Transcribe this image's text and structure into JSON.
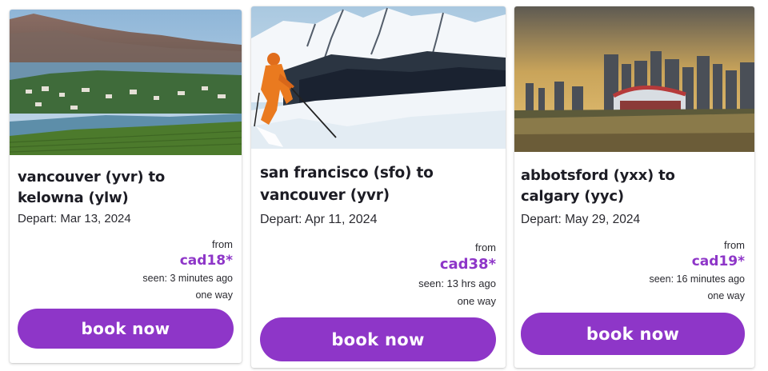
{
  "deals": [
    {
      "route_line1": "vancouver (yvr) to",
      "route_line2": "kelowna (ylw)",
      "depart": "Depart: Mar 13, 2024",
      "from_label": "from",
      "price": "cad18*",
      "seen": "seen: 3 minutes ago",
      "trip_type": "one way",
      "button_label": "book now",
      "image": "lake-vineyard-photo"
    },
    {
      "route_line1": "san francisco (sfo) to",
      "route_line2": "vancouver (yvr)",
      "depart": "Depart: Apr 11, 2024",
      "from_label": "from",
      "price": "cad38*",
      "seen": "seen: 13 hrs ago",
      "trip_type": "one way",
      "button_label": "book now",
      "image": "skier-mountain-photo"
    },
    {
      "route_line1": "abbotsford (yxx) to",
      "route_line2": "calgary (yyc)",
      "depart": "Depart: May 29, 2024",
      "from_label": "from",
      "price": "cad19*",
      "seen": "seen: 16 minutes ago",
      "trip_type": "one way",
      "button_label": "book now",
      "image": "city-skyline-photo"
    }
  ],
  "colors": {
    "accent": "#8e36c8",
    "button_text": "#ffffff",
    "card_bg": "#ffffff"
  }
}
